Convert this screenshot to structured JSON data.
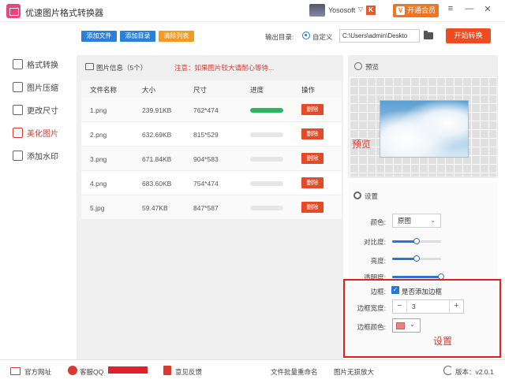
{
  "app": {
    "title": "优速图片格式转换器"
  },
  "user": {
    "name": "Yososoft",
    "caret": "▽",
    "vip_icon_label": "K",
    "vip_button": "开通会员"
  },
  "window": {
    "menu": "≡",
    "minimize": "—",
    "maximize": "☐",
    "close": "✕"
  },
  "sidebar": {
    "items": [
      {
        "label": "格式转换",
        "icon": "convert-icon",
        "active": false
      },
      {
        "label": "图片压缩",
        "icon": "compress-icon",
        "active": false
      },
      {
        "label": "更改尺寸",
        "icon": "resize-icon",
        "active": false
      },
      {
        "label": "美化图片",
        "icon": "beautify-icon",
        "active": true
      },
      {
        "label": "添加水印",
        "icon": "watermark-icon",
        "active": false
      }
    ]
  },
  "toolbar": {
    "add_file": "添加文件",
    "add_folder": "添加目录",
    "clear_list": "清除列表",
    "output_label": "输出目录:",
    "custom_label": "自定义",
    "output_path": "C:\\Users\\admin\\Deskto",
    "start": "开始转换",
    "colors": {
      "blue": "#2b7fd9",
      "orange": "#f39a1f",
      "start": "#f04b1f"
    }
  },
  "file_info": {
    "title": "图片信息（5个）",
    "note": "注意：如果图片较大请耐心等待..."
  },
  "table": {
    "headers": [
      "文件名称",
      "大小",
      "尺寸",
      "进度",
      "操作"
    ],
    "rows": [
      {
        "name": "1.png",
        "size": "239.91KB",
        "dims": "762*474",
        "progress": 1.0,
        "action": "删除"
      },
      {
        "name": "2.png",
        "size": "632.69KB",
        "dims": "815*529",
        "progress": 0.0,
        "action": "删除"
      },
      {
        "name": "3.png",
        "size": "671.84KB",
        "dims": "904*583",
        "progress": 0.0,
        "action": "删除"
      },
      {
        "name": "4.png",
        "size": "683.60KB",
        "dims": "754*474",
        "progress": 0.0,
        "action": "删除"
      },
      {
        "name": "5.jpg",
        "size": "59.47KB",
        "dims": "847*587",
        "progress": 0.0,
        "action": "删除"
      }
    ]
  },
  "preview": {
    "title": "预览",
    "caption": "预览"
  },
  "settings": {
    "title": "设置",
    "color_label": "颜色:",
    "color_value": "原图",
    "contrast_label": "对比度:",
    "contrast": 0.5,
    "brightness_label": "亮度:",
    "brightness": 0.5,
    "opacity_label": "透明度:",
    "opacity": 1.0,
    "border_label": "边框:",
    "border_checkbox_label": "是否添加边框",
    "border_checked": true,
    "border_width_label": "边框宽度:",
    "border_width": "3",
    "minus": "−",
    "plus": "+",
    "border_color_label": "边框颜色:",
    "border_color": "#ee7f7f",
    "caption": "设置"
  },
  "footer": {
    "website": "官方网址",
    "support_qq": "客服QQ",
    "feedback": "意见反馈",
    "batch_rename": "文件批量重命名",
    "lossless_enlarge": "图片无损放大",
    "version": "版本：v2.0.1"
  }
}
